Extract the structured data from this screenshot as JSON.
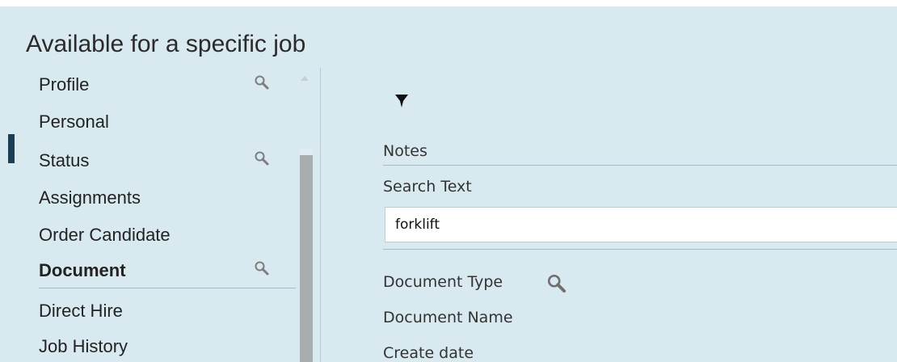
{
  "page": {
    "title": "Available for a specific job"
  },
  "sidebar": {
    "items": [
      {
        "label": "Profile",
        "has_search": true
      },
      {
        "label": "Personal",
        "has_search": false
      },
      {
        "label": "Status",
        "has_search": true,
        "active": true
      },
      {
        "label": "Assignments",
        "has_search": false
      },
      {
        "label": "Order Candidate",
        "has_search": false
      },
      {
        "label": "Document",
        "has_search": true,
        "bold": true
      },
      {
        "label": "Direct Hire",
        "has_search": false
      },
      {
        "label": "Job History",
        "has_search": false
      }
    ]
  },
  "filters": {
    "notes_label": "Notes",
    "search_text_label": "Search Text",
    "search_text_value": "forklift",
    "document_type_label": "Document Type",
    "document_name_label": "Document Name",
    "create_date_label": "Create date"
  },
  "icons": {
    "filter": "filter-icon",
    "search": "search-icon",
    "scroll_up": "chevron-up-icon"
  },
  "colors": {
    "background": "#d9e9f0",
    "active_indicator": "#1c3f57",
    "scroll_thumb": "#a8adb0"
  }
}
